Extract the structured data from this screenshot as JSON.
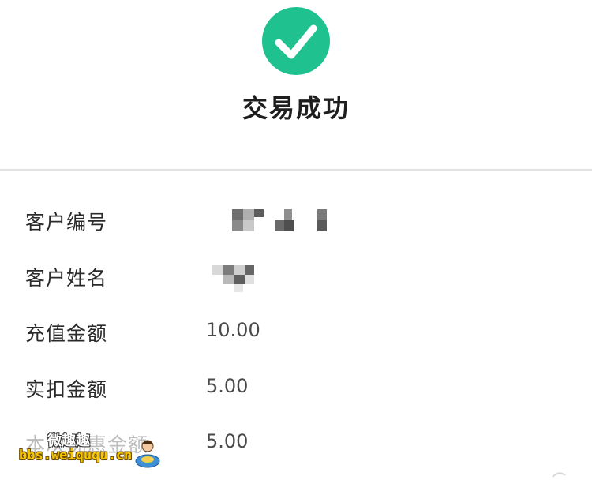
{
  "status": {
    "icon": "checkmark-circle-icon",
    "title": "交易成功",
    "accent_color": "#1fc18f"
  },
  "details": [
    {
      "label": "客户编号",
      "value": "",
      "redacted": true
    },
    {
      "label": "客户姓名",
      "value": "",
      "redacted": true
    },
    {
      "label": "充值金额",
      "value": "10.00",
      "redacted": false
    },
    {
      "label": "实扣金额",
      "value": "5.00",
      "redacted": false
    },
    {
      "label": "本次优惠金额",
      "value": "5.00",
      "redacted": false
    }
  ],
  "watermark": {
    "text_cn": "微趣趣",
    "url": "bbs.weiququ.cn"
  }
}
